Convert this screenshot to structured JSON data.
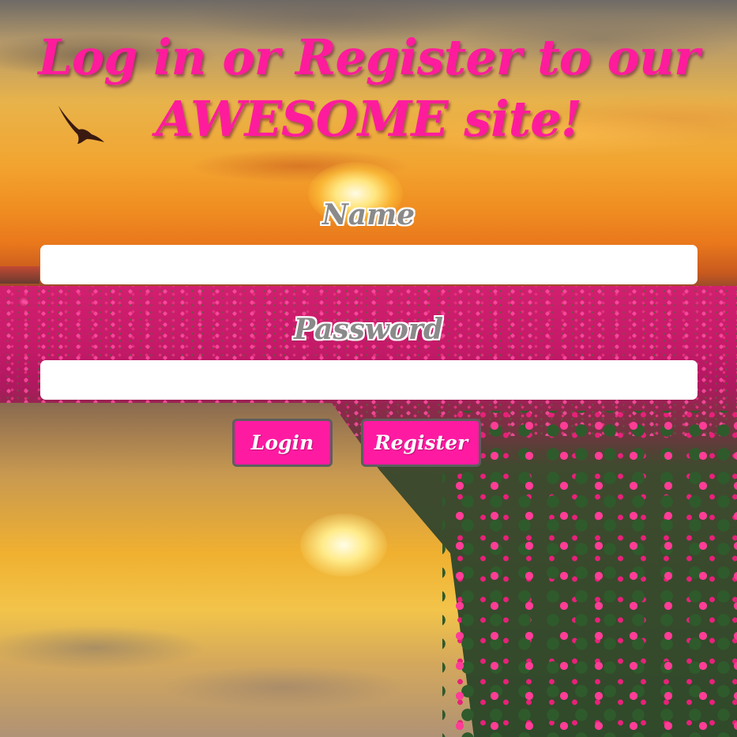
{
  "page": {
    "title_line1": "Log in or Register to our",
    "title_line2": "AWESOME site!"
  },
  "form": {
    "name_label": "Name",
    "name_value": "",
    "password_label": "Password",
    "password_value": "",
    "login_label": "Login",
    "register_label": "Register"
  },
  "colors": {
    "accent": "#ff1c9c",
    "button_bg": "#ff1aa2",
    "button_border": "#5e5e5e",
    "label_text": "#8a8a8a",
    "input_bg": "#ffffff"
  },
  "background": {
    "icon": "sunset-lotus-lake-photo"
  }
}
